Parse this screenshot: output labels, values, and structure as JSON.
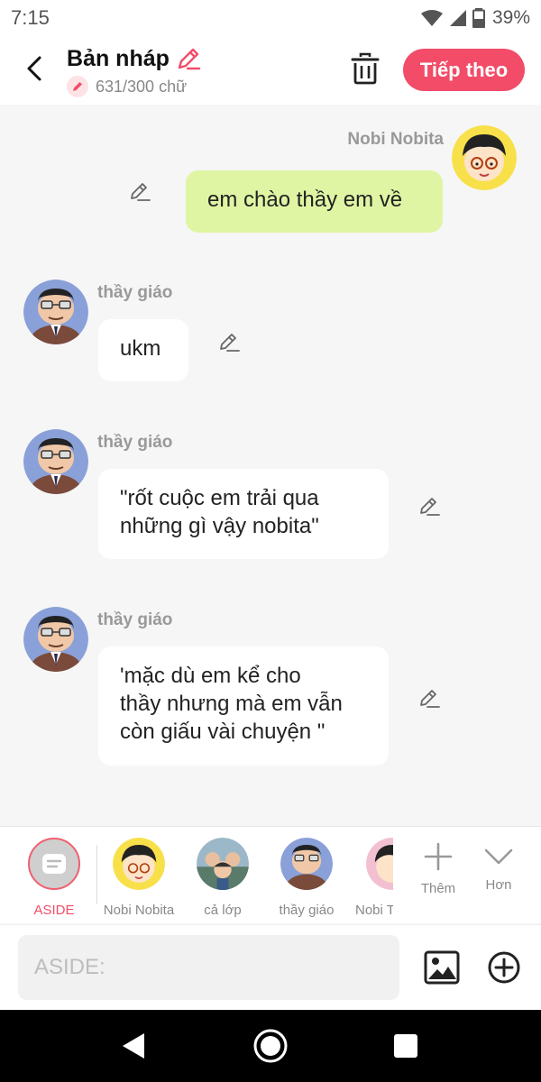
{
  "status": {
    "time": "7:15",
    "battery": "39%"
  },
  "header": {
    "title": "Bản nháp",
    "counter": "631/300 chữ",
    "next_label": "Tiếp theo"
  },
  "messages": [
    {
      "sender": "Nobi Nobita",
      "side": "right",
      "text": "em chào thầy em về"
    },
    {
      "sender": "thầy giáo",
      "side": "left",
      "text": "ukm"
    },
    {
      "sender": "thầy giáo",
      "side": "left",
      "text": "\"rốt cuộc em trải qua\nnhững gì vậy nobita\""
    },
    {
      "sender": "thầy giáo",
      "side": "left",
      "text": "'mặc dù em kể cho\nthầy nhưng mà em vẫn\ncòn giấu vài chuyện \""
    }
  ],
  "characters": [
    {
      "label": "ASIDE",
      "selected": true
    },
    {
      "label": "Nobi Nobita"
    },
    {
      "label": "cả lớp"
    },
    {
      "label": "thầy giáo"
    },
    {
      "label": "Nobi T"
    }
  ],
  "tools": {
    "add_label": "Thêm",
    "more_label": "Hơn"
  },
  "input": {
    "placeholder": "ASIDE:"
  },
  "colors": {
    "accent": "#f24c68",
    "green_bubble": "#dff5a4"
  }
}
